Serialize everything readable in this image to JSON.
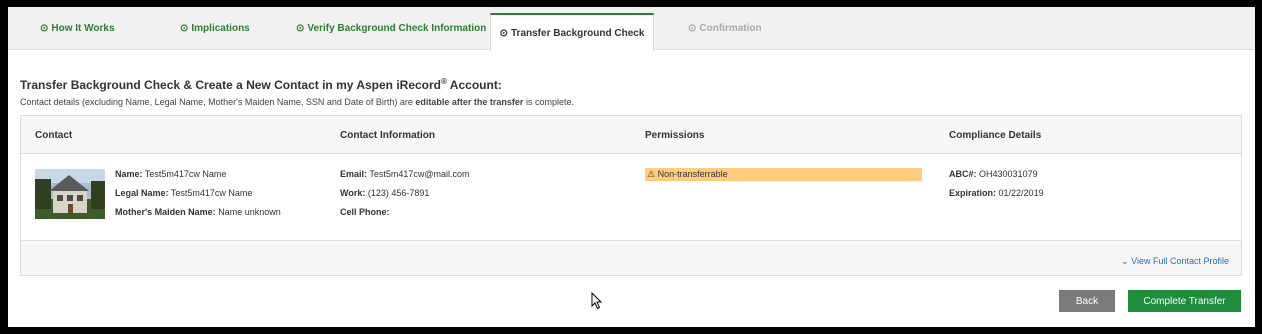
{
  "tabs": [
    {
      "label": "How It Works",
      "icon": "circle-arrow-icon",
      "state": "complete"
    },
    {
      "label": "Implications",
      "icon": "circle-arrow-icon",
      "state": "complete"
    },
    {
      "label": "Verify Background Check Information",
      "icon": "circle-arrow-icon",
      "state": "complete"
    },
    {
      "label": "Transfer Background Check",
      "icon": "circle-arrow-icon",
      "state": "active"
    },
    {
      "label": "Confirmation",
      "icon": "circle-arrow-icon",
      "state": "disabled"
    }
  ],
  "heading": {
    "title_pre": "Transfer Background Check & Create a New Contact in my Aspen iRecord",
    "reg": "®",
    "title_post": " Account:"
  },
  "subtext": {
    "pre": "Contact details (excluding Name, Legal Name, Mother's Maiden Name, SSN and Date of Birth) are ",
    "bold": "editable after the transfer",
    "post": " is complete."
  },
  "table": {
    "headers": [
      "Contact",
      "Contact Information",
      "Permissions",
      "Compliance Details"
    ],
    "contact": {
      "name_label": "Name:",
      "name": "Test5m417cw Name",
      "legal_label": "Legal Name:",
      "legal_name": "Test5m417cw Name",
      "maiden_label": "Mother's Maiden Name:",
      "maiden_name": "Name unknown"
    },
    "info": {
      "email_label": "Email:",
      "email": "Test5m417cw@mail.com",
      "work_label": "Work:",
      "work": "(123) 456-7891",
      "cell_label": "Cell Phone:",
      "cell": ""
    },
    "permissions": {
      "badge": "Non-transferrable",
      "icon": "warning-triangle-icon",
      "color": "#ffcc80"
    },
    "compliance": {
      "abc_label": "ABC#:",
      "abc": "OH430031079",
      "exp_label": "Expiration:",
      "expiration": "01/22/2019"
    },
    "view_link": "View Full Contact Profile"
  },
  "buttons": {
    "back": "Back",
    "complete": "Complete Transfer"
  },
  "colors": {
    "brand_green": "#2e7d32",
    "primary_button": "#1e8c3a",
    "secondary_button": "#7b7b7b",
    "link": "#2a6ebb"
  }
}
